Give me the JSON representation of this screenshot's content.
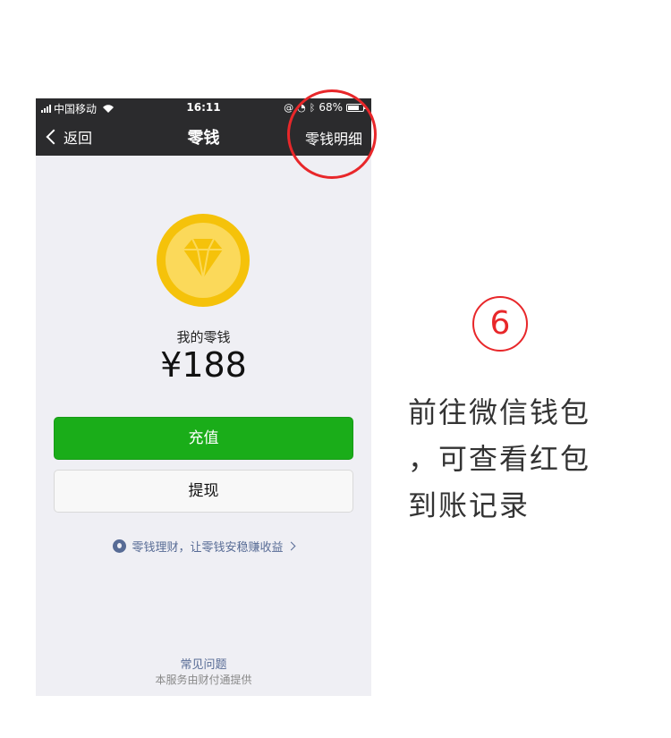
{
  "status_bar": {
    "carrier": "中国移动",
    "time": "16:11",
    "battery": "68%"
  },
  "nav": {
    "back_label": "返回",
    "title": "零钱",
    "detail_label": "零钱明细"
  },
  "wallet": {
    "balance_label": "我的零钱",
    "balance_amount": "¥188",
    "recharge_label": "充值",
    "withdraw_label": "提现",
    "licai_text": "零钱理财，让零钱安稳赚收益",
    "faq_label": "常见问题",
    "provider_text": "本服务由财付通提供"
  },
  "annotation": {
    "step_number": "6",
    "caption_lines": [
      "前往微信钱包",
      "，可查看红包",
      "到账记录"
    ]
  },
  "colors": {
    "accent_red": "#e8272a",
    "wechat_green": "#1aad19",
    "link_blue": "#576b95",
    "coin_gold": "#f5c20a"
  }
}
